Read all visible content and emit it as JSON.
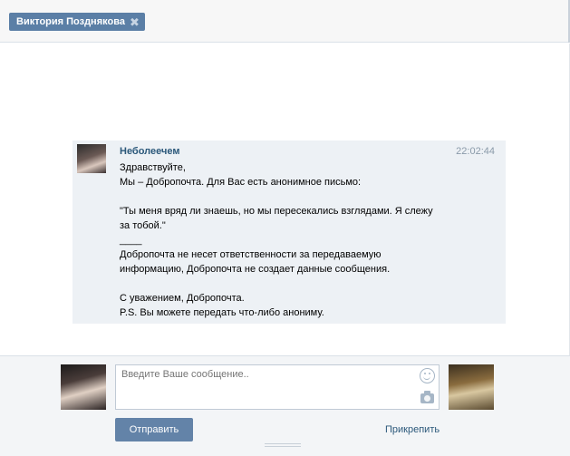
{
  "header": {
    "chip_label": "Виктория Позднякова",
    "chip_close": "✖"
  },
  "message": {
    "author": "Неболеечем",
    "time": "22:02:44",
    "lines": [
      "Здравствуйте,",
      "Мы – Добропочта. Для Вас есть анонимное письмо:",
      "",
      "\"Ты меня вряд ли знаешь, но мы пересекались взглядами. Я слежу",
      "за тобой.\"",
      "____",
      "Добропочта не несет ответственности за передаваемую",
      "информацию, Добропочта не создает данные сообщения.",
      "",
      "С уважением, Добропочта.",
      "P.S. Вы можете передать что-либо анониму."
    ]
  },
  "composer": {
    "placeholder": "Введите Ваше сообщение..",
    "value": "",
    "send_label": "Отправить",
    "attach_label": "Прикрепить"
  },
  "icons": {
    "chip_close": "close-icon",
    "emoji": "smile-icon",
    "photo": "camera-icon"
  },
  "colors": {
    "accent": "#5b7fa6",
    "button": "#6383a8",
    "link": "#2b587a",
    "message_bg": "#edf1f5"
  }
}
